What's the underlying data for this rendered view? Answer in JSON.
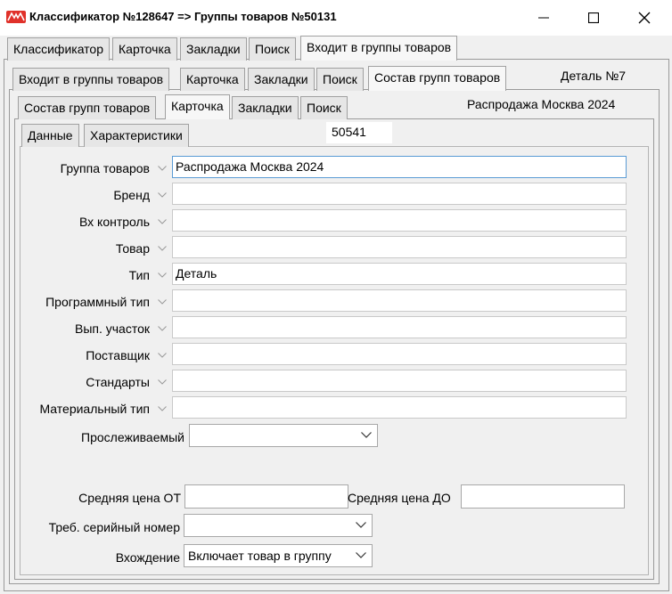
{
  "window": {
    "title": "Классификатор №128647 => Группы товаров №50131",
    "controls": [
      "minimize",
      "maximize",
      "close"
    ]
  },
  "tabs_level1": {
    "items": [
      "Классификатор",
      "Карточка",
      "Закладки",
      "Поиск",
      "Входит в группы товаров"
    ],
    "active": "Входит в группы товаров"
  },
  "tabs_level2": {
    "items": [
      "Входит в группы товаров",
      "Карточка",
      "Закладки",
      "Поиск",
      "Состав групп товаров"
    ],
    "active": "Состав групп товаров",
    "info": "Деталь №7"
  },
  "tabs_level3": {
    "items": [
      "Состав групп товаров",
      "Карточка",
      "Закладки",
      "Поиск"
    ],
    "active": "Карточка",
    "info": "Распродажа Москва 2024"
  },
  "tabs_level4": {
    "items": [
      "Данные",
      "Характеристики"
    ],
    "active": "Данные",
    "record_id": "50541"
  },
  "form": {
    "fields": [
      {
        "label": "Группа товаров",
        "value": "Распродажа Москва 2024"
      },
      {
        "label": "Бренд",
        "value": ""
      },
      {
        "label": "Вх контроль",
        "value": ""
      },
      {
        "label": "Товар",
        "value": ""
      },
      {
        "label": "Тип",
        "value": "Деталь"
      },
      {
        "label": "Программный тип",
        "value": ""
      },
      {
        "label": "Вып. участок",
        "value": ""
      },
      {
        "label": "Поставщик",
        "value": ""
      },
      {
        "label": "Стандарты",
        "value": ""
      },
      {
        "label": "Материальный тип",
        "value": ""
      }
    ],
    "tracked": {
      "label": "Прослеживаемый",
      "value": ""
    },
    "avg_price_from": {
      "label": "Средняя цена ОТ",
      "value": ""
    },
    "avg_price_to": {
      "label": "Средняя цена ДО",
      "value": ""
    },
    "serial_required": {
      "label": "Треб. серийный номер",
      "value": ""
    },
    "inclusion": {
      "label": "Вхождение",
      "value": "Включает товар в группу"
    }
  },
  "colors": {
    "logo_red": "#e0312a",
    "focus_border": "#5a9bd5",
    "panel_bg": "#f0f0f0"
  }
}
